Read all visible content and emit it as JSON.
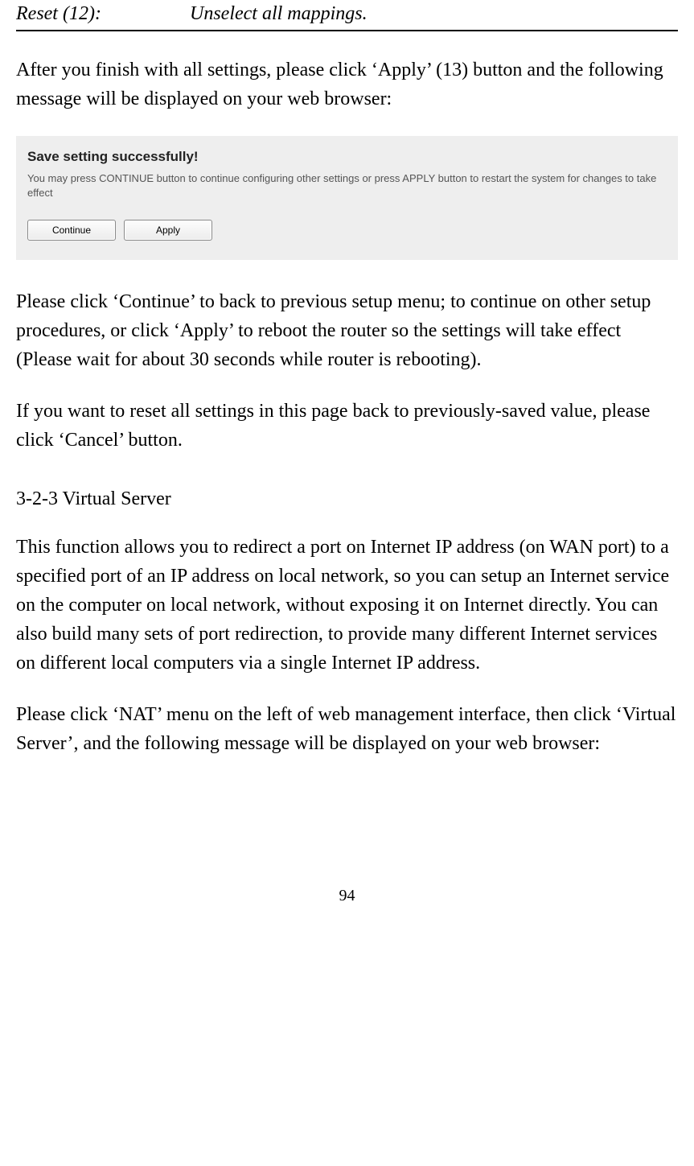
{
  "reset": {
    "label": "Reset (12):",
    "desc": "Unselect all mappings."
  },
  "para1": "After you finish with all settings, please click ‘Apply’ (13) button and the following message will be displayed on your web browser:",
  "dialog": {
    "title": "Save setting successfully!",
    "desc": "You may press CONTINUE button to continue configuring other settings or press APPLY button to restart the system for changes to take effect",
    "continue_label": "Continue",
    "apply_label": "Apply"
  },
  "para2": "Please click ‘Continue’ to back to previous setup menu; to continue on other setup procedures, or click ‘Apply’ to reboot the router so the settings will take effect (Please wait for about 30 seconds while router is rebooting).",
  "para3": "If you want to reset all settings in this page back to previously-saved value, please click ‘Cancel’ button.",
  "section_title": "3-2-3 Virtual Server",
  "para4": "This function allows you to redirect a port on Internet IP address (on WAN port) to a specified port of an IP address on local network, so you can setup an Internet service on the computer on local network, without exposing it on Internet directly. You can also build many sets of port redirection, to provide many different Internet services on different local computers via a single Internet IP address.",
  "para5": "Please click ‘NAT’ menu on the left of web management interface, then click ‘Virtual Server’, and the following message will be displayed on your web browser:",
  "page_number": "94"
}
